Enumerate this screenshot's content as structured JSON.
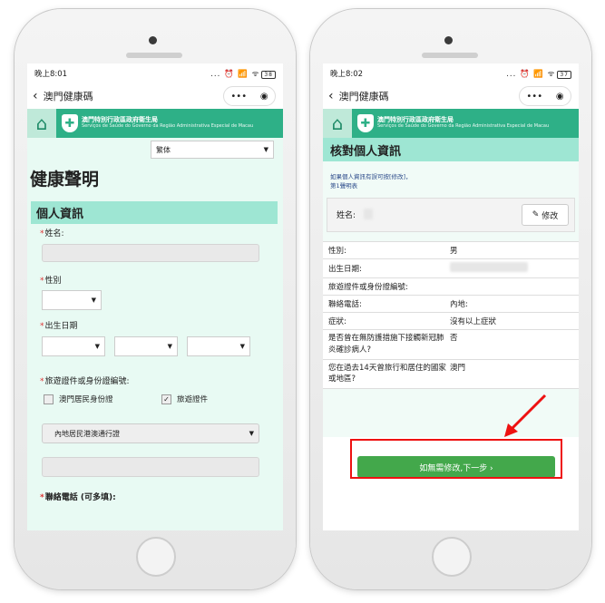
{
  "left": {
    "status_time": "晚上8:01",
    "status_icons": "... ⏰ 📶 ᯤ",
    "battery": "38",
    "nav_title": "澳門健康碼",
    "capsule_menu": "•••",
    "capsule_close": "◉",
    "banner_line1": "澳門特別行政區政府衛生局",
    "banner_line2": "Serviços de Saúde do Governo da Região Administrativa Especial de Macau",
    "lang_select": "繁体",
    "page_title": "健康聲明",
    "section_title": "個人資訊",
    "req_mark": "*",
    "name_label": "姓名:",
    "gender_label": "性別",
    "dob_label": "出生日期",
    "id_label": "旅遊證件或身份證編號:",
    "opt_macau_id": "澳門居民身份證",
    "opt_travel_doc": "旅遊證件",
    "doc_type_select": "內地居民港澳通行證",
    "phone_label": "聯絡電話 (可多填):"
  },
  "right": {
    "status_time": "晚上8:02",
    "status_icons": "... ⏰ 📶 ᯤ",
    "battery": "37",
    "nav_title": "澳門健康碼",
    "capsule_menu": "•••",
    "capsule_close": "◉",
    "banner_line1": "澳門特別行政區政府衛生局",
    "banner_line2": "Serviços de Saúde do Governo da Região Administrativa Especial de Macau",
    "section_title": "核對個人資訊",
    "hint_line1": "如果個人資訊有誤可按[修改]，",
    "hint_line2": "第1聲明表",
    "name_label": "姓名:",
    "edit_button": "修改",
    "rows": [
      {
        "k": "性別:",
        "v": "男"
      },
      {
        "k": "出生日期:",
        "v": ""
      },
      {
        "k": "旅遊證件或身份證編號:",
        "v": ""
      },
      {
        "k": "聯絡電話:",
        "v": "內地:"
      },
      {
        "k": "症狀:",
        "v": "沒有以上症狀"
      },
      {
        "k": "是否曾在無防護措施下接觸新冠肺炎確診病人?",
        "v": "否"
      },
      {
        "k": "您在過去14天曾旅行和居住的國家或地區?",
        "v": "澳門"
      }
    ],
    "next_button": "如無需修改,下一步 ›"
  },
  "colors": {
    "banner": "#2eb087",
    "bg": "#e8faf3",
    "section": "#9ee6d3",
    "next": "#43a84b",
    "highlight": "#e11111"
  }
}
